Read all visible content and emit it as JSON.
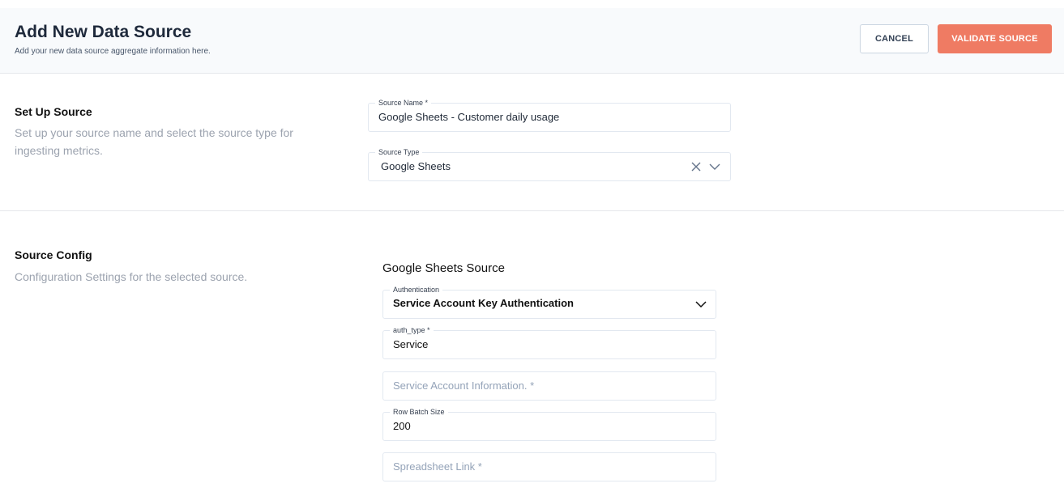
{
  "header": {
    "title": "Add New Data Source",
    "subtitle": "Add your new data source aggregate information here.",
    "cancel_label": "CANCEL",
    "validate_label": "VALIDATE SOURCE",
    "accent": "#ef7b63"
  },
  "setup": {
    "title": "Set Up Source",
    "description": "Set up your source name and select the source type for ingesting metrics.",
    "source_name": {
      "label": "Source Name *",
      "value": "Google Sheets - Customer daily usage"
    },
    "source_type": {
      "label": "Source Type",
      "value": "Google Sheets"
    }
  },
  "config": {
    "title": "Source Config",
    "description": "Configuration Settings for the selected source.",
    "heading": "Google Sheets Source",
    "authentication": {
      "label": "Authentication",
      "value": "Service Account Key Authentication"
    },
    "auth_type": {
      "label": "auth_type *",
      "value": "Service"
    },
    "service_account": {
      "placeholder": "Service Account Information. *"
    },
    "row_batch_size": {
      "label": "Row Batch Size",
      "value": "200"
    },
    "spreadsheet_link": {
      "placeholder": "Spreadsheet Link *"
    }
  }
}
